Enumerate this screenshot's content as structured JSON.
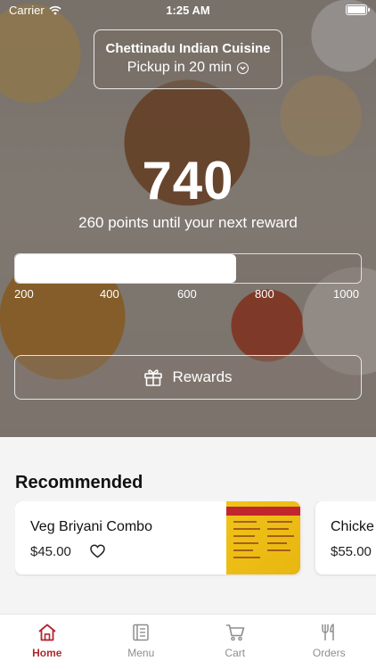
{
  "status_bar": {
    "carrier": "Carrier",
    "time": "1:25 AM"
  },
  "store": {
    "name": "Chettinadu Indian Cuisine",
    "pickup": "Pickup in 20 min"
  },
  "rewards": {
    "points": "740",
    "remaining_text": "260 points until your next reward",
    "progress_fraction": 0.64,
    "ticks": [
      "200",
      "400",
      "600",
      "800",
      "1000"
    ],
    "button_label": "Rewards"
  },
  "recommended": {
    "title": "Recommended",
    "items": [
      {
        "name": "Veg Briyani Combo",
        "price": "$45.00"
      },
      {
        "name": "Chicke",
        "price": "$55.00"
      }
    ]
  },
  "tabs": [
    {
      "label": "Home",
      "icon": "home-icon",
      "active": true
    },
    {
      "label": "Menu",
      "icon": "menu-book-icon",
      "active": false
    },
    {
      "label": "Cart",
      "icon": "cart-icon",
      "active": false
    },
    {
      "label": "Orders",
      "icon": "fork-knife-icon",
      "active": false
    }
  ],
  "colors": {
    "accent": "#b0282e"
  }
}
